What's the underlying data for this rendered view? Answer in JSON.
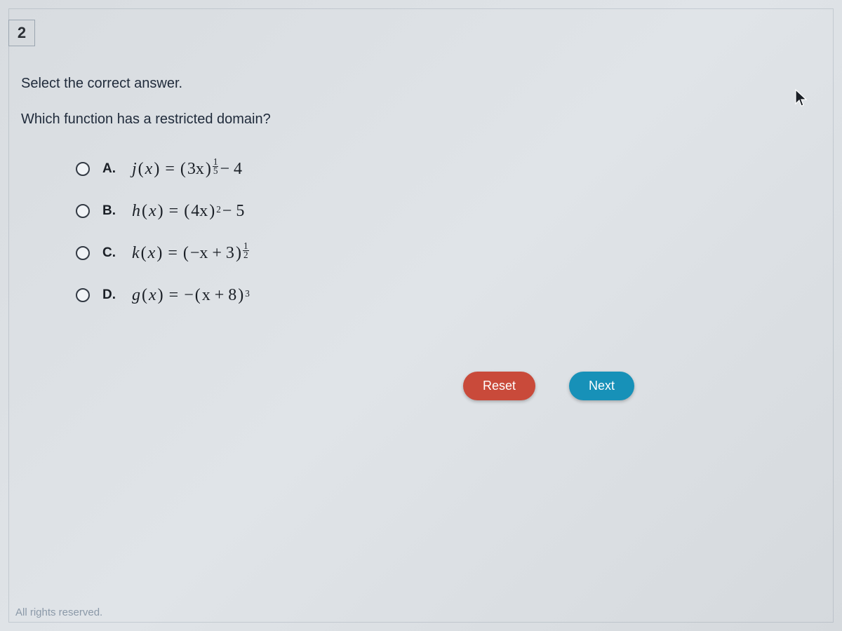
{
  "question_number": "2",
  "instruction": "Select the correct answer.",
  "question": "Which function has a restricted domain?",
  "options": {
    "a": {
      "letter": "A.",
      "fn": "j",
      "base": "3x",
      "exp_num": "1",
      "exp_den": "5",
      "tail": " − 4",
      "leading_minus": "",
      "plain_exp": ""
    },
    "b": {
      "letter": "B.",
      "fn": "h",
      "base": "4x",
      "exp_num": "",
      "exp_den": "",
      "tail": " − 5",
      "leading_minus": "",
      "plain_exp": "2"
    },
    "c": {
      "letter": "C.",
      "fn": "k",
      "base": "−x + 3",
      "exp_num": "1",
      "exp_den": "2",
      "tail": "",
      "leading_minus": "",
      "plain_exp": ""
    },
    "d": {
      "letter": "D.",
      "fn": "g",
      "base": "x + 8",
      "exp_num": "",
      "exp_den": "",
      "tail": "",
      "leading_minus": "−",
      "plain_exp": "3"
    }
  },
  "buttons": {
    "reset": "Reset",
    "next": "Next"
  },
  "footer": "All rights reserved."
}
